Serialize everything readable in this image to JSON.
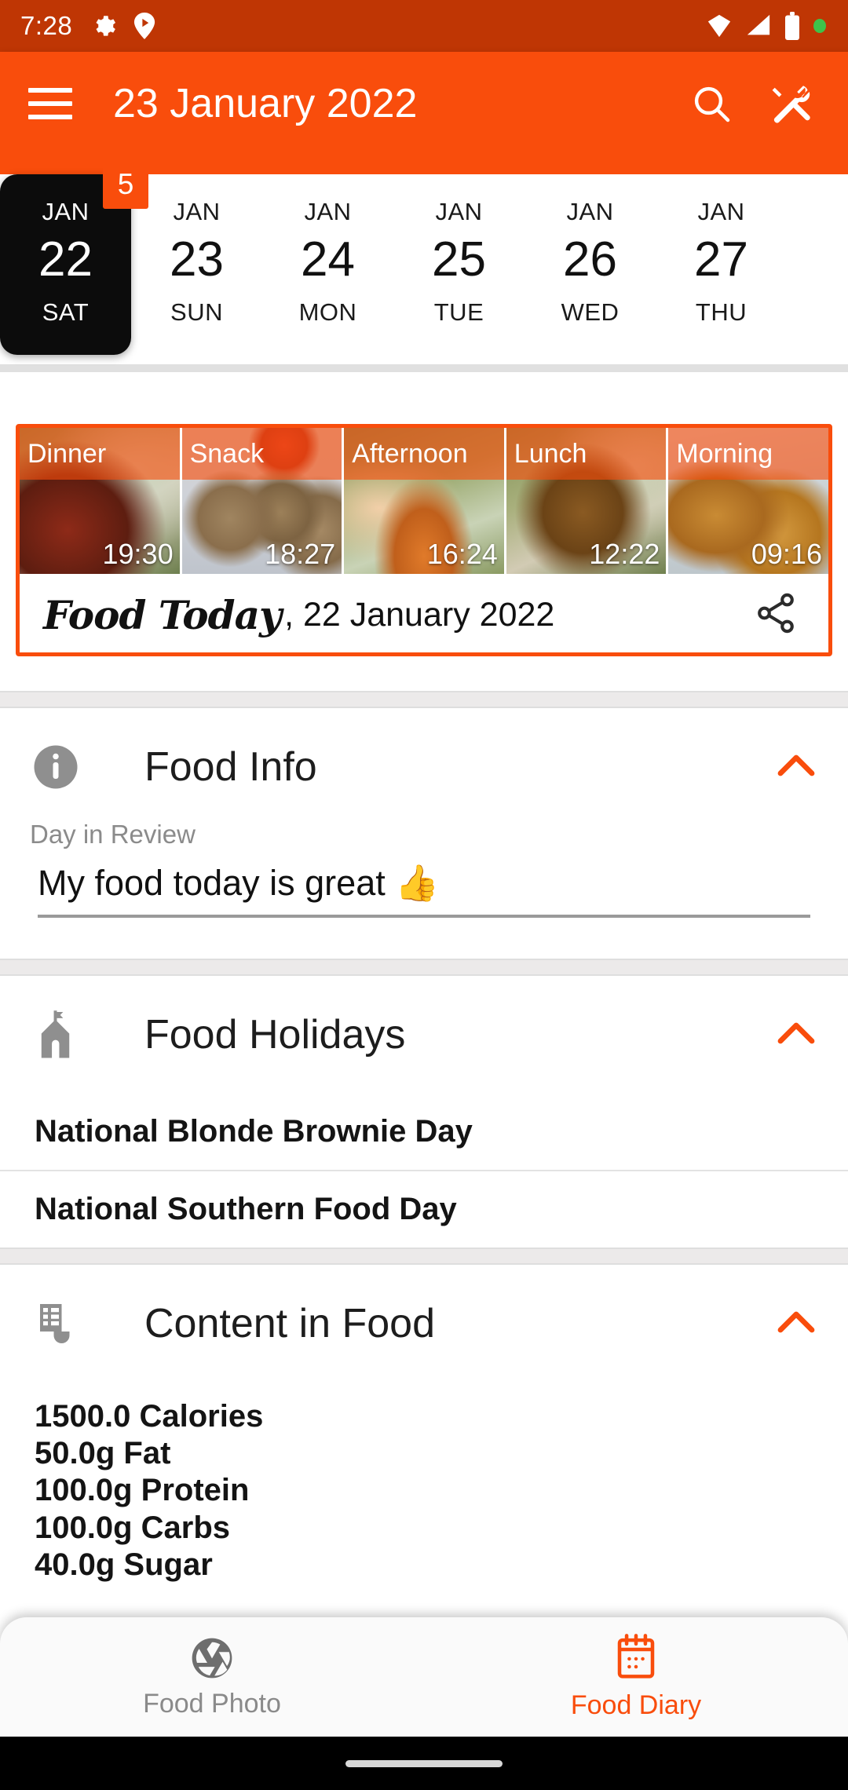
{
  "status_bar": {
    "time": "7:28",
    "left_icons": [
      "gear-icon",
      "play-badge-icon"
    ],
    "right_icons": [
      "wifi-icon",
      "signal-icon",
      "battery-icon",
      "dot-indicator-icon"
    ]
  },
  "app_bar": {
    "menu_icon": "hamburger-menu-icon",
    "title": "23 January 2022",
    "actions": [
      {
        "name": "search-icon",
        "label": "Search"
      },
      {
        "name": "tools-icon",
        "label": "Tools"
      }
    ],
    "background_color": "#F94D0C"
  },
  "date_strip": {
    "days": [
      {
        "month": "JAN",
        "day": "22",
        "weekday": "SAT",
        "selected": true,
        "badge": "5"
      },
      {
        "month": "JAN",
        "day": "23",
        "weekday": "SUN",
        "selected": false,
        "badge": ""
      },
      {
        "month": "JAN",
        "day": "24",
        "weekday": "MON",
        "selected": false,
        "badge": ""
      },
      {
        "month": "JAN",
        "day": "25",
        "weekday": "TUE",
        "selected": false,
        "badge": ""
      },
      {
        "month": "JAN",
        "day": "26",
        "weekday": "WED",
        "selected": false,
        "badge": ""
      },
      {
        "month": "JAN",
        "day": "27",
        "weekday": "THU",
        "selected": false,
        "badge": ""
      }
    ]
  },
  "meal_card": {
    "meals": [
      {
        "label": "Dinner",
        "time": "19:30"
      },
      {
        "label": "Snack",
        "time": "18:27"
      },
      {
        "label": "Afternoon",
        "time": "16:24"
      },
      {
        "label": "Lunch",
        "time": "12:22"
      },
      {
        "label": "Morning",
        "time": "09:16"
      }
    ],
    "footer_script": "Food Today",
    "footer_rest": ", 22 January 2022",
    "share_icon": "share-icon"
  },
  "sections": [
    {
      "icon": "info-circle-icon",
      "title": "Food Info",
      "expanded": true,
      "subtitle": "Day in Review",
      "input_value": "My food today is great 👍"
    },
    {
      "icon": "church-icon",
      "title": "Food Holidays",
      "expanded": true,
      "items": [
        "National Blonde Brownie Day",
        "National Southern Food Day"
      ]
    },
    {
      "icon": "nutrition-table-icon",
      "title": "Content in Food",
      "expanded": true,
      "items": [
        "1500.0 Calories",
        "50.0g Fat",
        "100.0g Protein",
        "100.0g Carbs",
        "40.0g Sugar"
      ]
    }
  ],
  "bottom_nav": {
    "items": [
      {
        "label": "Food Photo",
        "icon": "aperture-icon",
        "active": false
      },
      {
        "label": "Food Diary",
        "icon": "calendar-icon",
        "active": true
      }
    ],
    "accent_color": "#F94D0C"
  }
}
